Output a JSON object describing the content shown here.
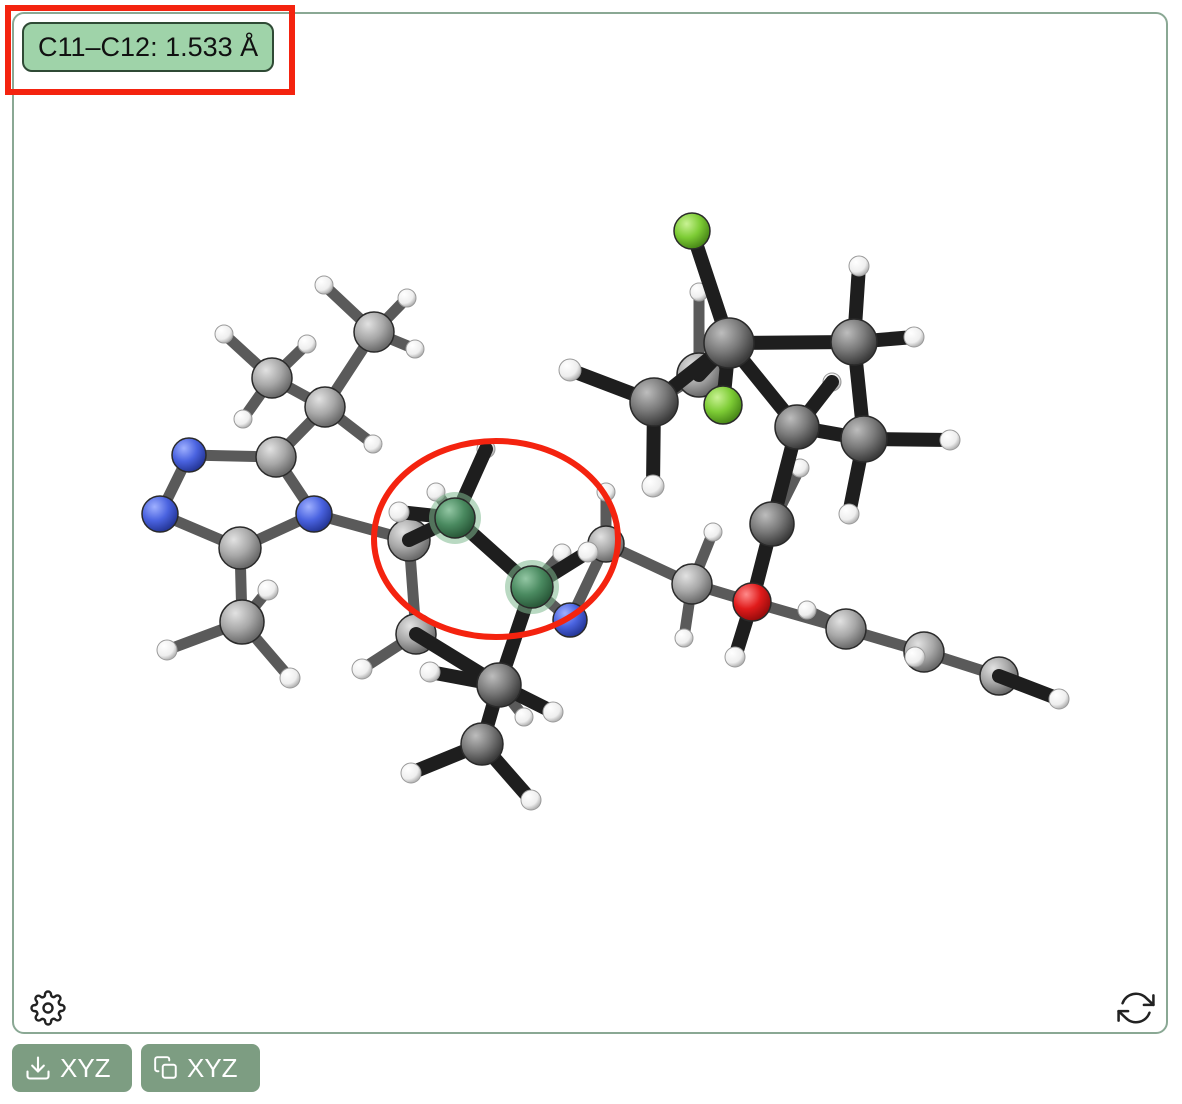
{
  "viewer": {
    "measurement_label": "C11–C12: 1.533 Å",
    "settings_icon": "gear-icon",
    "reset_icon": "refresh-icon"
  },
  "actions": {
    "download": {
      "icon": "download-icon",
      "label": "XYZ"
    },
    "copy": {
      "icon": "copy-icon",
      "label": "XYZ"
    }
  },
  "colors": {
    "carbon": "#7a7a7a",
    "hydrogen": "#f2f2f2",
    "nitrogen": "#4a63e0",
    "oxygen": "#e01b1b",
    "fluorine": "#7dcc35",
    "selected_atom": "#4a8a60",
    "bond_front": "#1e1e1e",
    "bond_back": "#5a5a5a",
    "border": "#8aa894",
    "button": "#7d9d82",
    "badge": "#9fd3a9",
    "annotation": "#f4230f"
  }
}
